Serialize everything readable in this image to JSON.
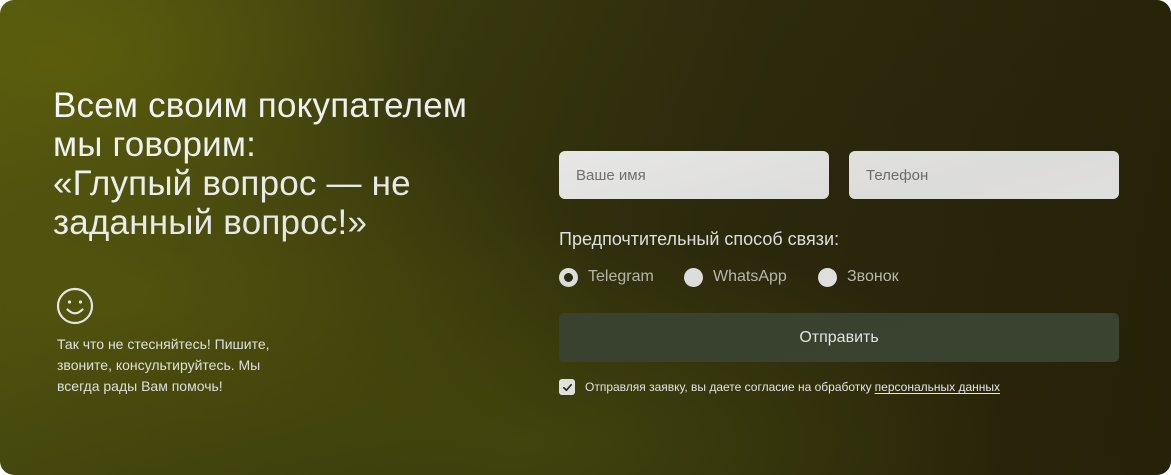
{
  "promo": {
    "headline_lines": [
      "Всем своим покупателем",
      "мы говорим:",
      "«Глупый вопрос — не",
      "заданный вопрос!»"
    ],
    "icon": "smiley-icon",
    "note_lines": [
      "Так что не стесняйтесь! Пишите,",
      "звоните, консультируйтесь. Мы",
      "всегда рады Вам помочь!"
    ]
  },
  "form": {
    "name_placeholder": "Ваше имя",
    "name_value": "",
    "phone_placeholder": "Телефон",
    "phone_value": "",
    "contact_label": "Предпочтительный способ связи:",
    "contact_options": [
      {
        "label": "Telegram",
        "selected": true
      },
      {
        "label": "WhatsApp",
        "selected": false
      },
      {
        "label": "Звонок",
        "selected": false
      }
    ],
    "submit_label": "Отправить",
    "consent_checked": true,
    "consent_text": "Отправляя заявку, вы даете согласие на обработку",
    "consent_link": "персональных данных"
  },
  "colors": {
    "button_bg": "#3f4a35",
    "background_left": "#4f5410",
    "background_right": "#292409"
  }
}
